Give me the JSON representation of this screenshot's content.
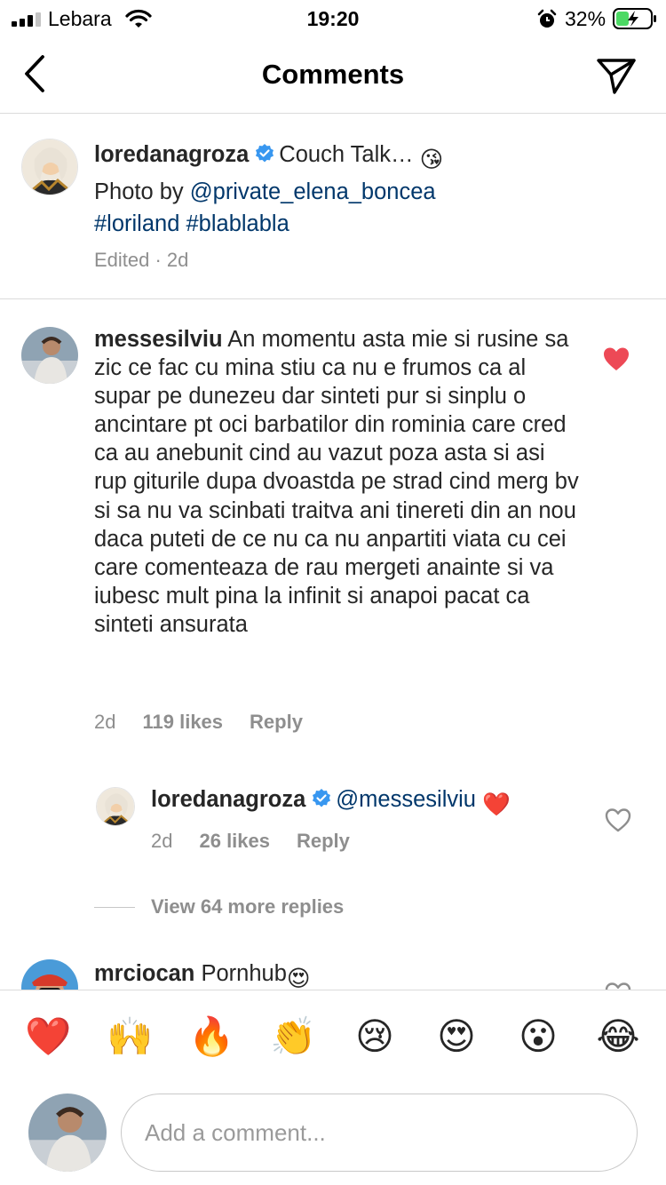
{
  "status_bar": {
    "carrier": "Lebara",
    "time": "19:20",
    "battery": "32%"
  },
  "header": {
    "title": "Comments",
    "back_icon": "chevron-left-icon",
    "share_icon": "paper-plane-icon"
  },
  "caption": {
    "username": "loredanagroza",
    "verified": true,
    "text_1": "Couch Talk…",
    "emoji": "😘",
    "text_2": "Photo by ",
    "mention": "@private_elena_boncea",
    "hashtags": "#loriland #blablabla",
    "meta": "Edited · 2d"
  },
  "comments": [
    {
      "username": "messesilviu",
      "text": "An momentu asta mie si rusine sa zic ce fac cu mina stiu ca nu e frumos ca al supar pe dunezeu dar sinteti pur si sinplu o ancintare pt oci barbatilor din rominia care cred ca au anebunit cind au vazut poza asta si asi rup giturile dupa dvoastda pe strad cind merg bv si sa nu va scinbati traitva ani tinereti din an nou daca puteti de ce nu ca nu anpartiti viata cu cei care comenteaza de rau mergeti anainte si va iubesc mult pina la infinit si anapoi pacat ca sinteti ansurata",
      "time": "2d",
      "likes": "119 likes",
      "reply": "Reply",
      "liked": true
    },
    {
      "username": "mrciocan",
      "text": "Pornhub",
      "emoji": "😍"
    }
  ],
  "reply": {
    "username": "loredanagroza",
    "verified": true,
    "mention": "@messesilviu",
    "emoji": "❤️",
    "time": "2d",
    "likes": "26 likes",
    "reply": "Reply",
    "liked": false
  },
  "view_more": "View 64 more replies",
  "emoji_bar": [
    "❤️",
    "🙌",
    "🔥",
    "👏",
    "😢",
    "😍",
    "😮",
    "😂"
  ],
  "composer": {
    "placeholder": "Add a comment..."
  },
  "colors": {
    "heart_red": "#ed4956",
    "link_blue": "#00376b",
    "verified_blue": "#3897f0",
    "secondary_text": "#8e8e8e"
  }
}
